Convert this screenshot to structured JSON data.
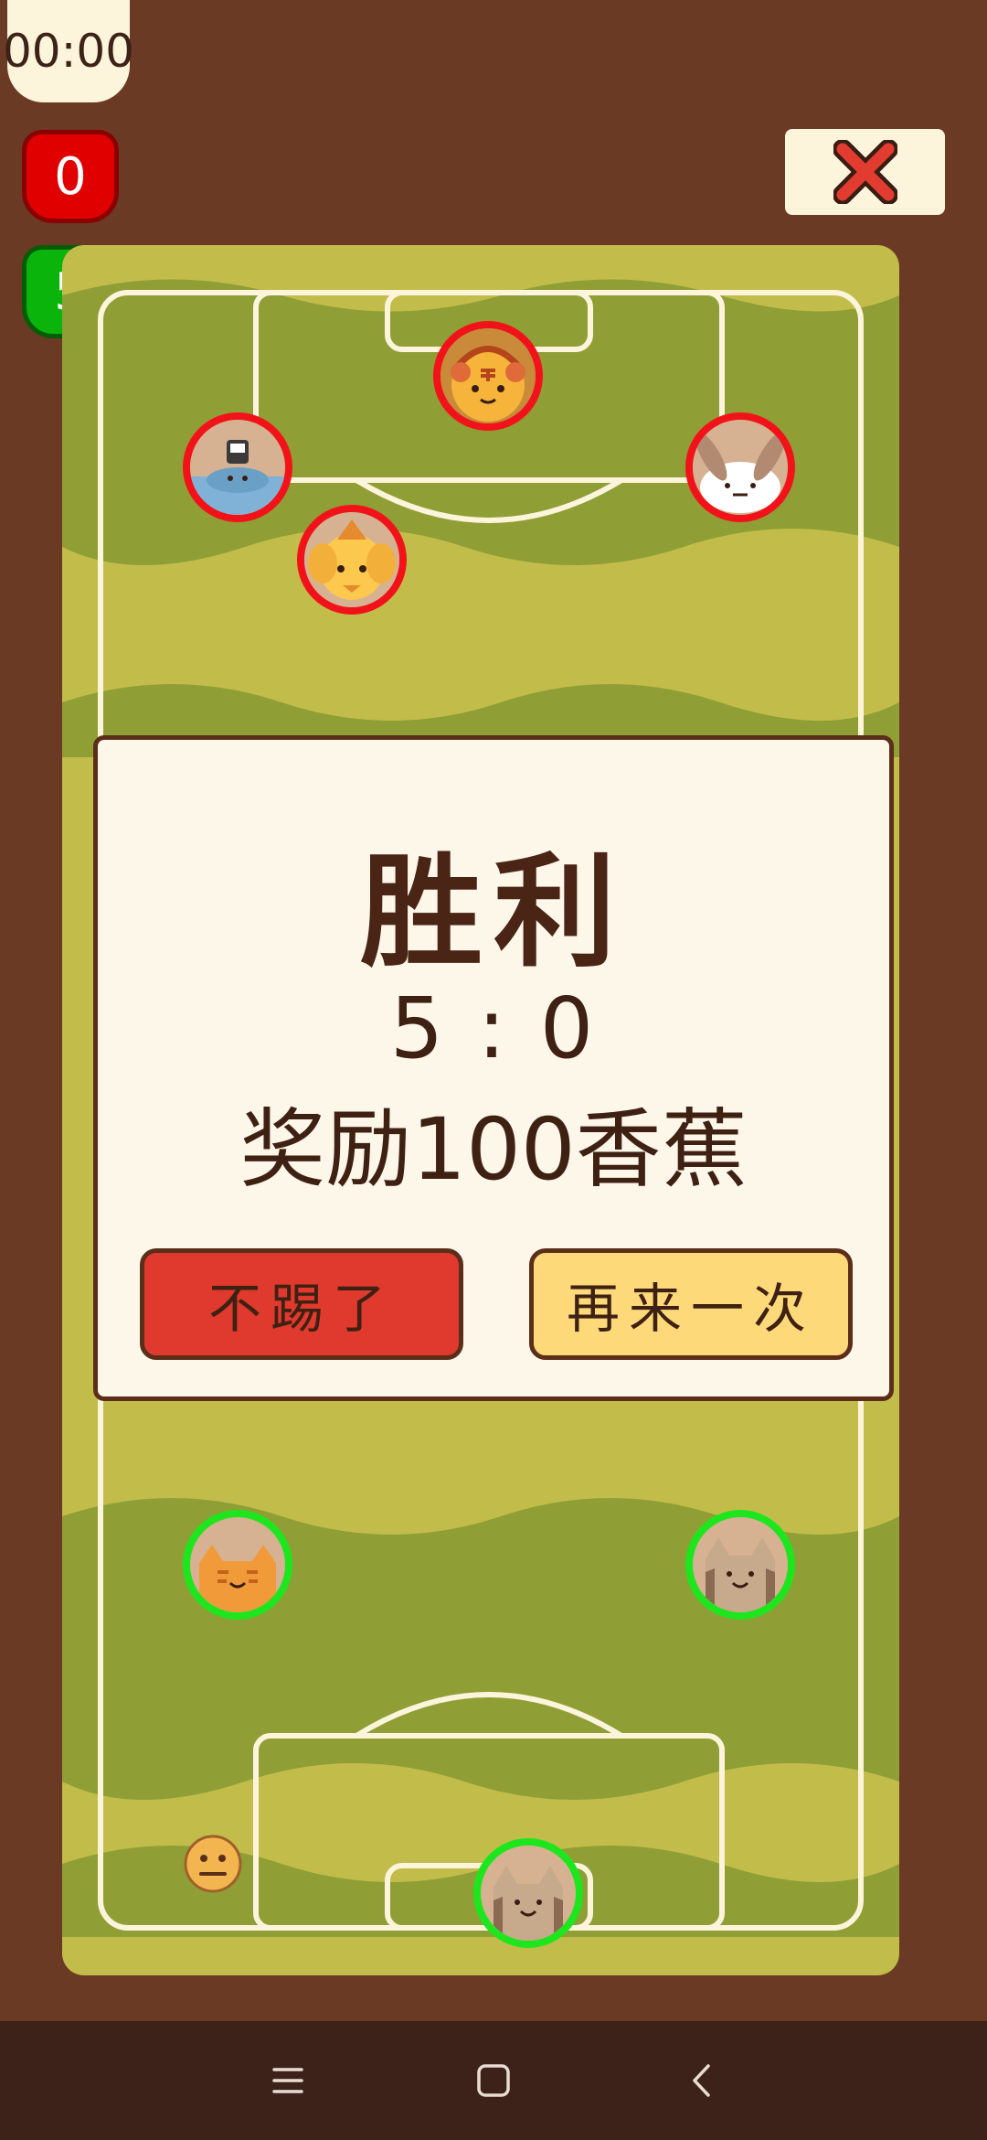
{
  "hud": {
    "timer": "00:00",
    "opponent_score": "0",
    "player_score": "5"
  },
  "result": {
    "title": "胜利",
    "score": "5 : 0",
    "reward": "奖励100香蕉",
    "quit_label": "不踢了",
    "again_label": "再来一次"
  },
  "icons": {
    "close": "close-icon",
    "emoji": "neutral-face-icon",
    "nav_menu": "menu-icon",
    "nav_home": "home-icon",
    "nav_back": "back-icon"
  },
  "colors": {
    "opponent": "#f2131a",
    "player": "#1ee61e",
    "background": "#6b3a24",
    "dialog": "#fdf7ea"
  }
}
